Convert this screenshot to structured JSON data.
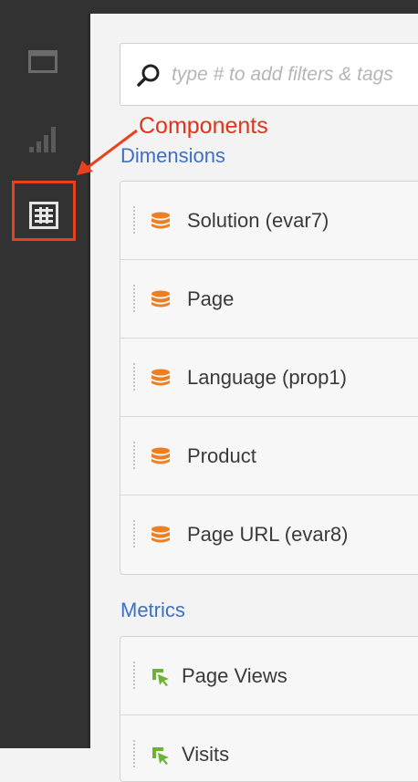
{
  "sidebar": {
    "items": [
      {
        "name": "panels",
        "icon": "panel-icon"
      },
      {
        "name": "visualizations",
        "icon": "bar-chart-icon"
      },
      {
        "name": "components",
        "icon": "components-icon",
        "selected": true
      }
    ]
  },
  "search": {
    "placeholder": "type # to add filters & tags",
    "icon": "search-icon"
  },
  "annotation": {
    "label": "Components",
    "color": "#e0331d"
  },
  "dimensions": {
    "label": "Dimensions",
    "items": [
      {
        "label": "Solution (evar7)",
        "icon": "dimension-icon"
      },
      {
        "label": "Page",
        "icon": "dimension-icon"
      },
      {
        "label": "Language (prop1)",
        "icon": "dimension-icon"
      },
      {
        "label": "Product",
        "icon": "dimension-icon"
      },
      {
        "label": "Page URL (evar8)",
        "icon": "dimension-icon"
      }
    ]
  },
  "metrics": {
    "label": "Metrics",
    "items": [
      {
        "label": "Page Views",
        "icon": "metric-icon"
      },
      {
        "label": "Visits",
        "icon": "metric-icon"
      }
    ]
  },
  "colors": {
    "sidebar": "#323232",
    "link_blue": "#3d6fc7",
    "dimension_orange": "#ee7f21",
    "metric_green": "#6cb238",
    "annotation_red": "#e8411b"
  }
}
